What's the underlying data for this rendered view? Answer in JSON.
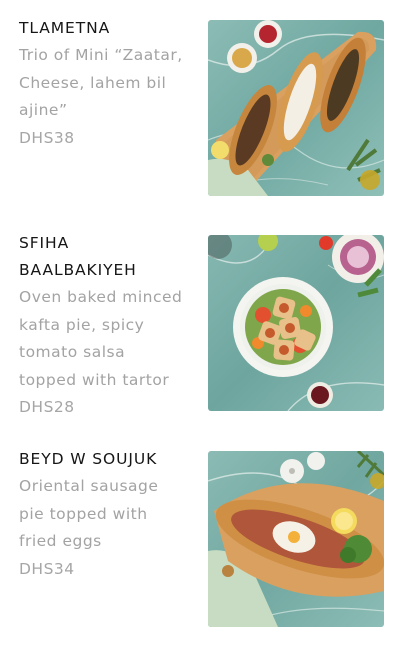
{
  "menu": {
    "items": [
      {
        "name_lines": [
          "TLAMETNA"
        ],
        "description_lines": [
          "Trio of Mini “Zaatar,",
          "Cheese, lahem bil",
          "ajine”"
        ],
        "price": "DHS38"
      },
      {
        "name_lines": [
          "SFIHA",
          "BAALBAKIYEH"
        ],
        "description_lines": [
          "Oven baked minced",
          "kafta pie, spicy",
          "tomato salsa",
          "topped with tartor"
        ],
        "price": "DHS28"
      },
      {
        "name_lines": [
          "BEYD W SOUJUK"
        ],
        "description_lines": [
          "Oriental sausage",
          "pie topped with",
          "fried eggs"
        ],
        "price": "DHS34"
      }
    ]
  },
  "colors": {
    "text_dark": "#161616",
    "text_muted": "#a3a3a3",
    "marble_teal": "#7fb3ad",
    "wood_board": "#d9a060",
    "background": "#ffffff"
  }
}
